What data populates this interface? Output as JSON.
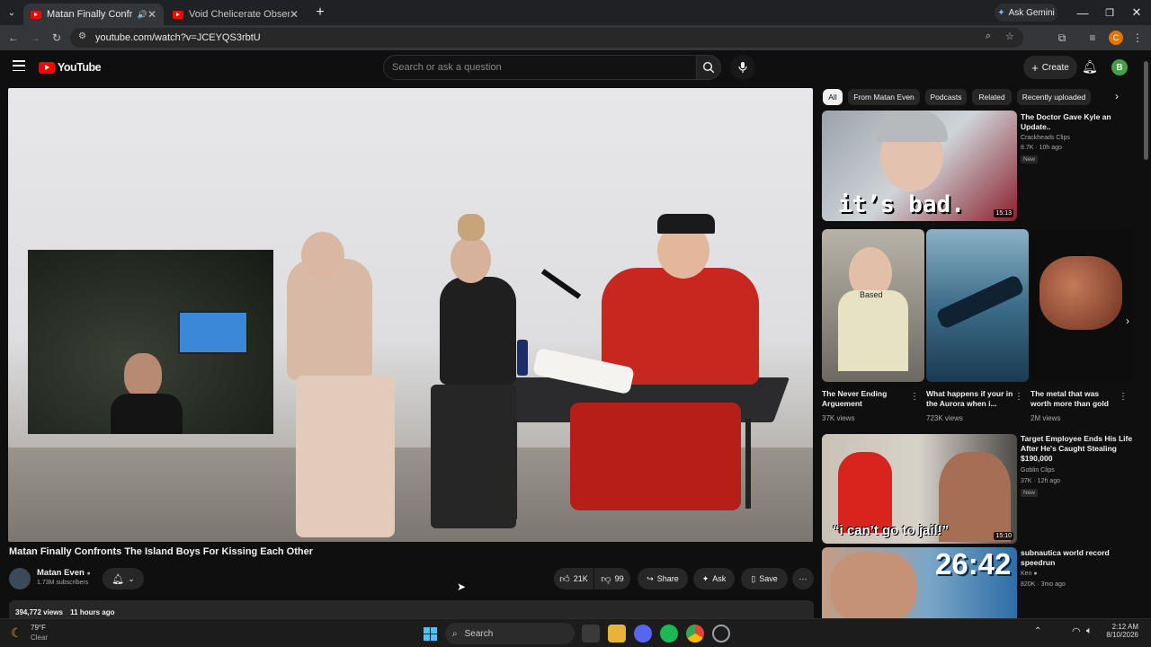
{
  "browser": {
    "tabs": [
      {
        "label": "Matan Finally Confronts The",
        "active": true
      },
      {
        "label": "Void Chelicerate Observatory",
        "active": false
      }
    ],
    "url": "youtube.com/watch?v=JCEYQS3rbtU",
    "ask_gemini": "Ask Gemini",
    "profile_initial": "C"
  },
  "youtube": {
    "logo": "YouTube",
    "search_placeholder": "Search or ask a question",
    "create_label": "Create",
    "avatar_initial": "B",
    "video": {
      "title": "Matan Finally Confronts The Island Boys For Kissing Each Other",
      "channel": "Matan Even",
      "subscribers": "1.73M subscribers",
      "likes": "21K",
      "dislikes": "99",
      "share": "Share",
      "ask": "Ask",
      "save": "Save",
      "views": "394,772 views",
      "age": "11 hours ago"
    },
    "chips": [
      "All",
      "From Matan Even",
      "Podcasts",
      "Related",
      "Recently uploaded"
    ],
    "recs": [
      {
        "title": "The Doctor Gave Kyle an Update..",
        "channel": "Crackheads Clips",
        "meta": "8.7K · 10h ago",
        "badge": "New",
        "duration": "15:13",
        "thumb_text": "it’s bad."
      },
      {
        "title": "Target Employee Ends His Life After He's Caught Stealing $190,000",
        "channel": "Goblin Clips",
        "meta": "37K · 12h ago",
        "badge": "New",
        "duration": "15:10",
        "thumb_text": "“i can’t go to jail!”"
      },
      {
        "title": "subnautica world record speedrun",
        "channel": "Ken",
        "meta": "820K · 3mo ago",
        "thumb_text": "26:42"
      }
    ],
    "shorts": [
      {
        "title": "The Never Ending Arguement",
        "views": "37K views",
        "thumb_text": "Based"
      },
      {
        "title": "What happens if your in the Aurora when i...",
        "views": "723K views"
      },
      {
        "title": "The metal that was worth more than gold",
        "views": "2M views"
      }
    ]
  },
  "taskbar": {
    "weather_temp": "79°F",
    "weather_desc": "Clear",
    "search": "Search",
    "time": "2:12 AM",
    "date": "8/10/2026"
  }
}
